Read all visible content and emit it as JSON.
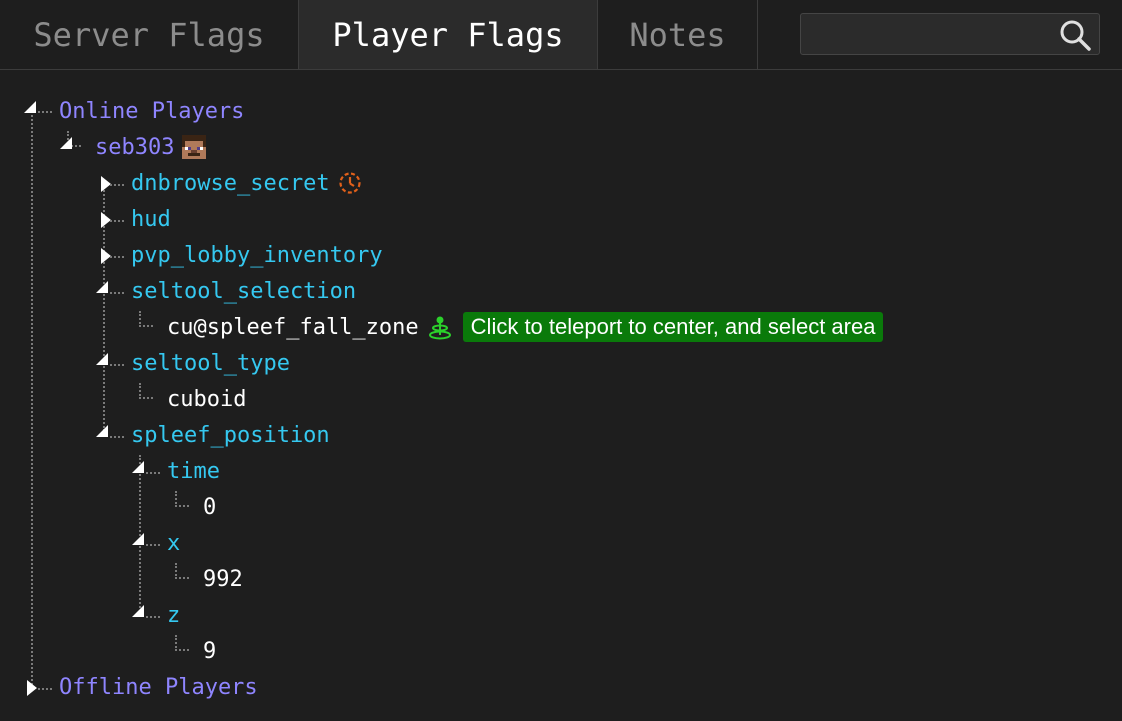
{
  "tabs": {
    "server_flags": "Server Flags",
    "player_flags": "Player Flags",
    "notes": "Notes"
  },
  "search": {
    "value": "",
    "icon": "search-icon"
  },
  "tree": {
    "online_players": "Online Players",
    "player_name": "seb303",
    "flags": {
      "dnbrowse_secret": "dnbrowse_secret",
      "hud": "hud",
      "pvp_lobby_inventory": "pvp_lobby_inventory",
      "seltool_selection": "seltool_selection",
      "seltool_selection_value": "cu@spleef_fall_zone",
      "teleport_tooltip": "Click to teleport to center, and select area",
      "seltool_type": "seltool_type",
      "seltool_type_value": "cuboid",
      "spleef_position": "spleef_position",
      "time": "time",
      "time_value": "0",
      "x": "x",
      "x_value": "992",
      "z": "z",
      "z_value": "9"
    },
    "offline_players": "Offline Players"
  },
  "colors": {
    "background": "#1e1e1e",
    "category": "#8f85ff",
    "flag_key": "#35c8f0",
    "value": "#ffffff",
    "tooltip_bg": "#0a7a0a",
    "expiry_icon": "#e0601a",
    "area_icon": "#2bd12b"
  }
}
